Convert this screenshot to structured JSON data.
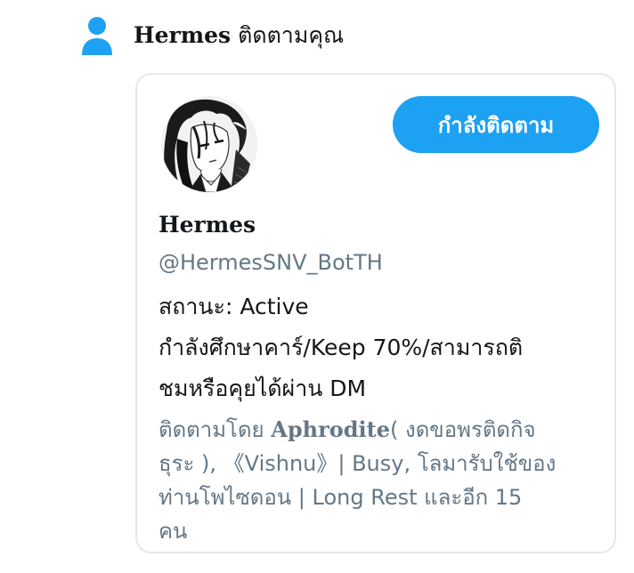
{
  "notification": {
    "actor_name": "Hermes",
    "action_text": "ติดตามคุณ",
    "icon": "person-icon",
    "icon_color": "#1da1f2"
  },
  "profile_card": {
    "avatar": "avatar-image",
    "follow_button_label": "กำลังติดตาม",
    "button_color": "#1da1f2",
    "display_name": "Hermes",
    "handle": "@HermesSNV_BotTH",
    "bio_lines": [
      "สถานะ: Active",
      "กำลังศึกษาคาร์/Keep 70%/สามารถติ",
      "ชมหรือคุยได้ผ่าน DM"
    ],
    "followed_by": {
      "prefix": "ติดตามโดย ",
      "first_name": "Aphrodite",
      "line1_rest": "( งดขอพรติดกิจ",
      "line2": "ธุระ ), 《Vishnu》| Busy, โลมารับใช้ของ",
      "line3": "ท่านโพไซดอน | Long Rest และอีก 15",
      "line4": "คน"
    }
  }
}
